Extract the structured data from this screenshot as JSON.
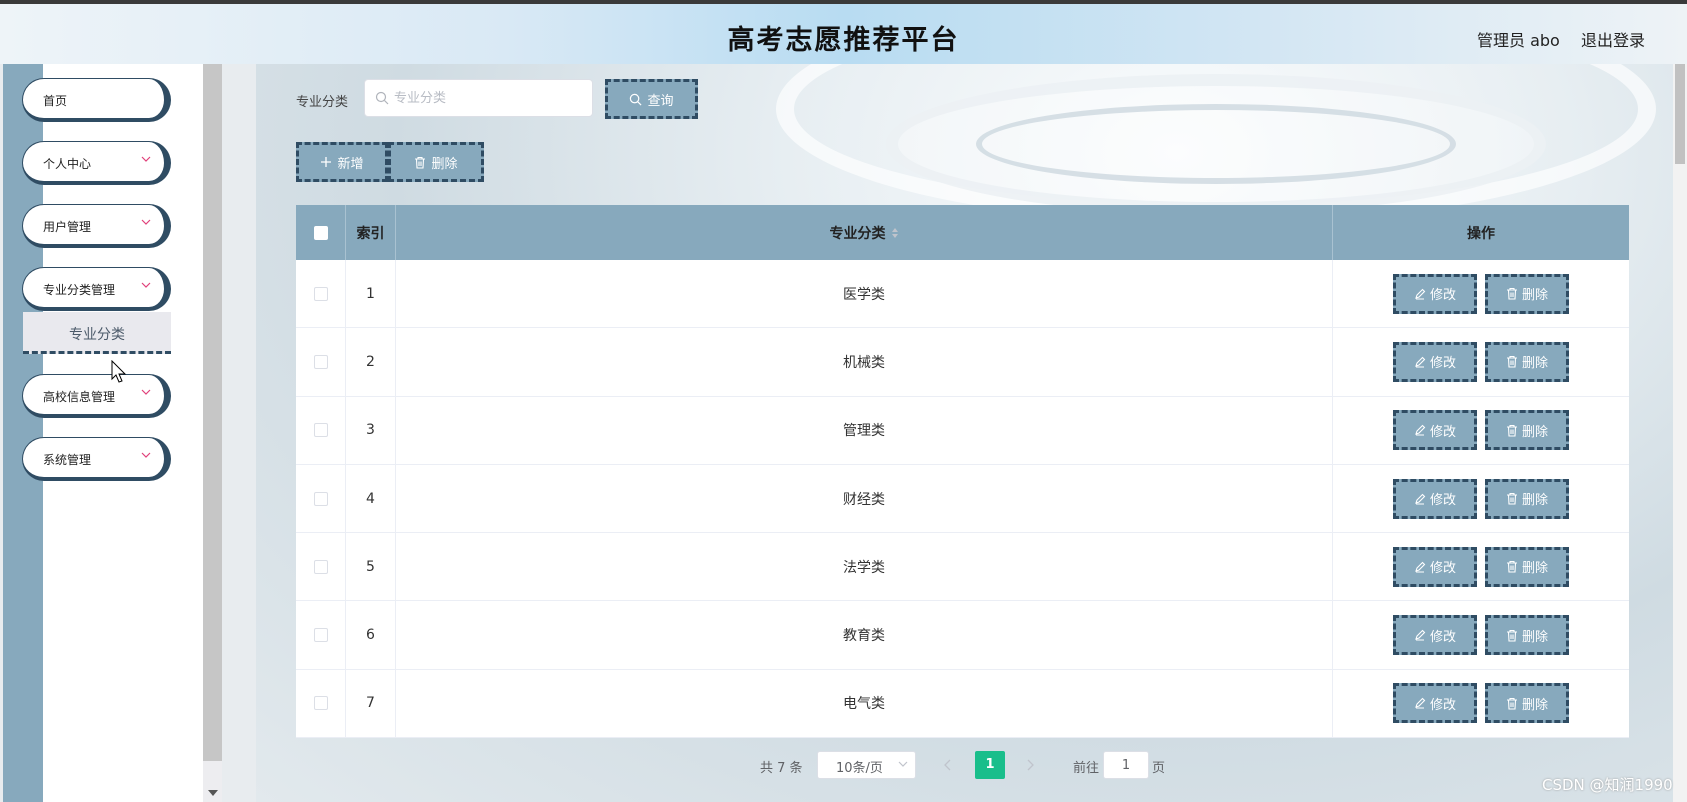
{
  "header": {
    "title": "高考志愿推荐平台",
    "user": "管理员 abo",
    "logout": "退出登录"
  },
  "sidebar": {
    "items": [
      {
        "label": "首页",
        "has_arrow": false
      },
      {
        "label": "个人中心",
        "has_arrow": true
      },
      {
        "label": "用户管理",
        "has_arrow": true
      },
      {
        "label": "专业分类管理",
        "has_arrow": true
      },
      {
        "label": "高校信息管理",
        "has_arrow": true
      },
      {
        "label": "系统管理",
        "has_arrow": true
      }
    ],
    "sub_item": "专业分类"
  },
  "search": {
    "label": "专业分类",
    "placeholder": "专业分类",
    "query_button": "查询"
  },
  "toolbar": {
    "add": "新增",
    "delete": "删除"
  },
  "table": {
    "headers": {
      "index": "索引",
      "name": "专业分类",
      "ops": "操作"
    },
    "rows": [
      {
        "index": "1",
        "name": "医学类"
      },
      {
        "index": "2",
        "name": "机械类"
      },
      {
        "index": "3",
        "name": "管理类"
      },
      {
        "index": "4",
        "name": "财经类"
      },
      {
        "index": "5",
        "name": "法学类"
      },
      {
        "index": "6",
        "name": "教育类"
      },
      {
        "index": "7",
        "name": "电气类"
      }
    ],
    "edit_label": "修改",
    "delete_label": "删除"
  },
  "pagination": {
    "total": "共 7 条",
    "page_size": "10条/页",
    "current_page": "1",
    "goto_label": "前往",
    "goto_value": "1",
    "page_unit": "页"
  },
  "watermark": "CSDN @知润1990",
  "colors": {
    "accent": "#87a9bd",
    "border": "#2f4c63",
    "page_active": "#19be8b"
  }
}
